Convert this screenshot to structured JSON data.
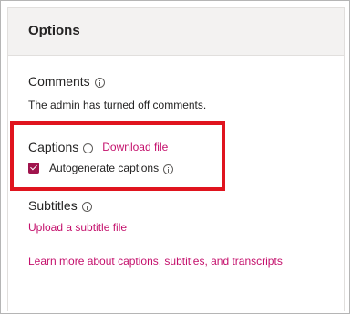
{
  "panel": {
    "title": "Options"
  },
  "comments": {
    "label": "Comments",
    "info_icon": "info-icon",
    "status_text": "The admin has turned off comments."
  },
  "captions": {
    "label": "Captions",
    "info_icon": "info-icon",
    "download_link": "Download file",
    "checkbox_label": "Autogenerate captions",
    "checkbox_checked": true
  },
  "subtitles": {
    "label": "Subtitles",
    "info_icon": "info-icon",
    "upload_link": "Upload a subtitle file"
  },
  "learn_more_link": "Learn more about captions, subtitles, and transcripts",
  "colors": {
    "accent": "#c4106c",
    "checkbox": "#a0144d",
    "highlight": "#e0141e",
    "header_bg": "#f3f2f1"
  }
}
